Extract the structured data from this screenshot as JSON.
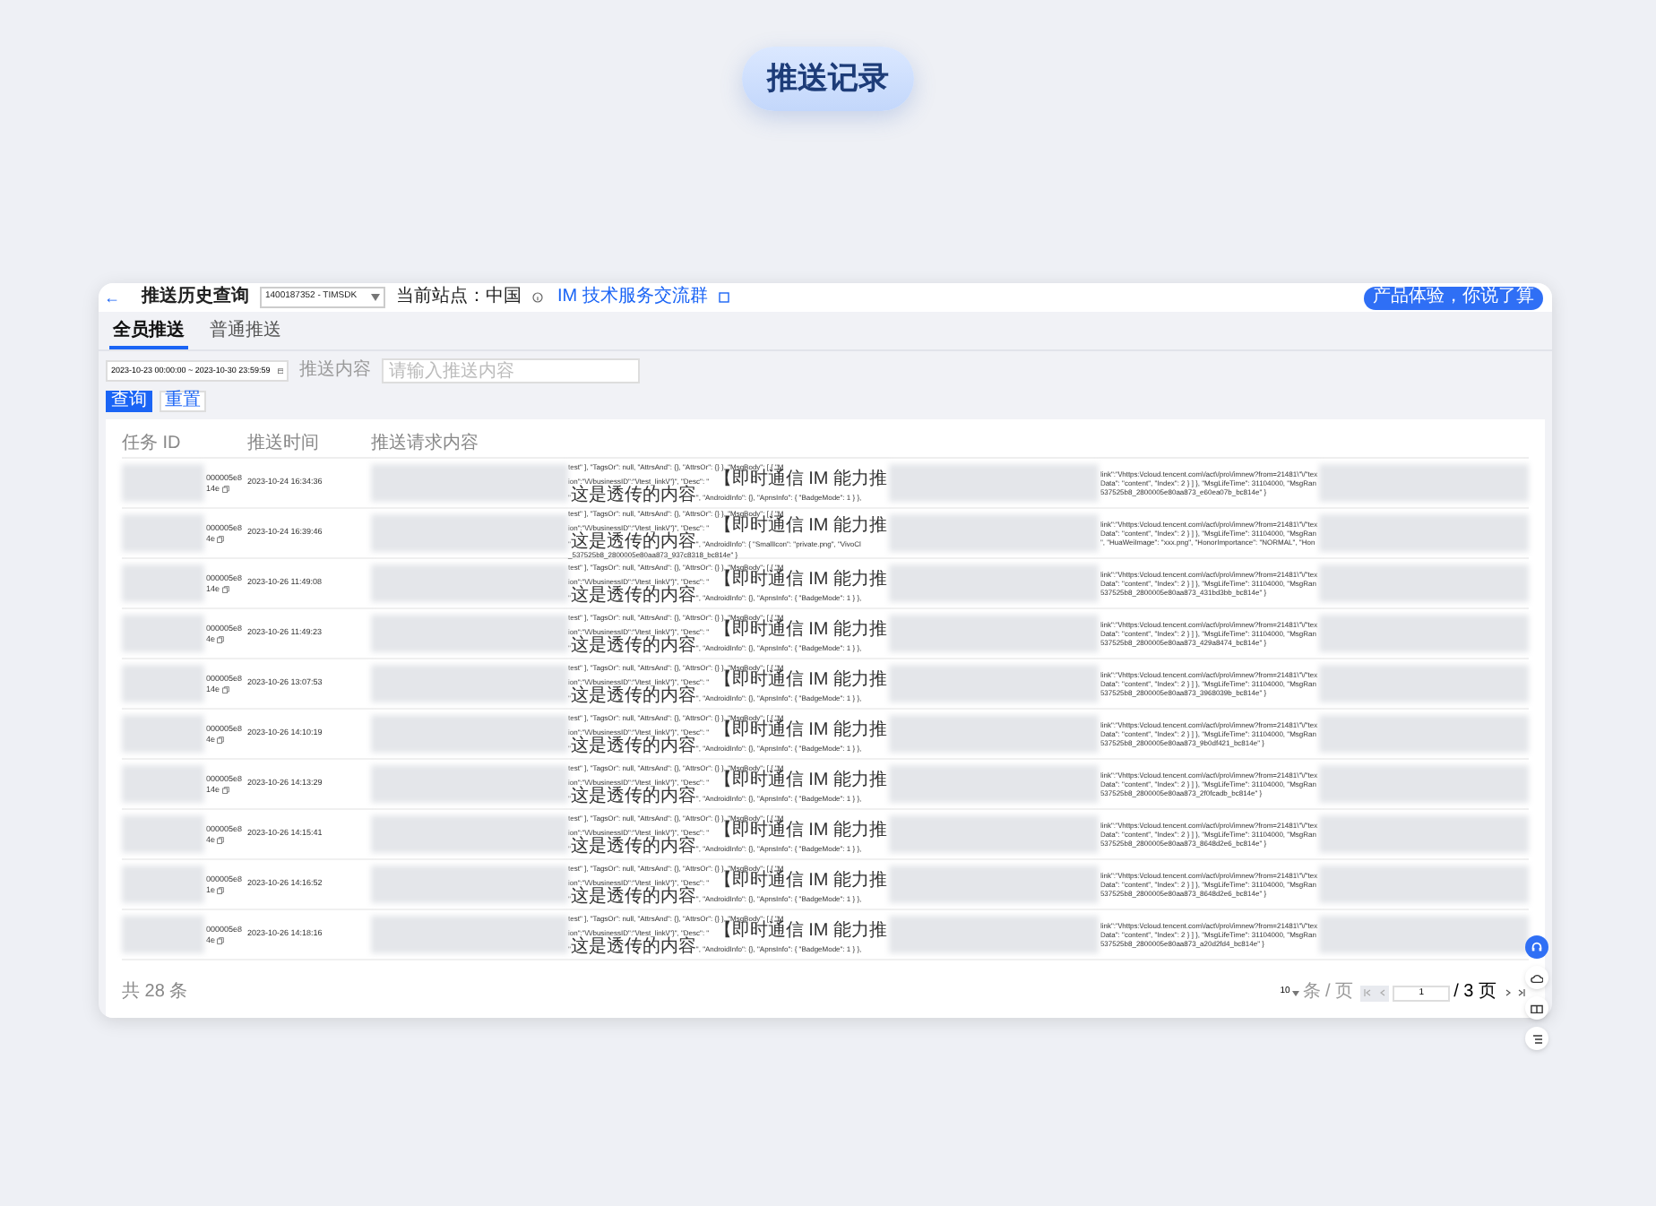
{
  "page_title": "推送记录",
  "window": {
    "back": "←",
    "title": "推送历史查询",
    "app_select": {
      "value": "1400187352 - TIMSDK"
    },
    "site": "当前站点：中国",
    "link": "IM 技术服务交流群",
    "feedback": "产品体验，你说了算"
  },
  "tabs": [
    {
      "label": "全员推送",
      "selected": true
    },
    {
      "label": "普通推送",
      "selected": false
    }
  ],
  "filters": {
    "date_range": "2023-10-23 00:00:00 ~ 2023-10-30 23:59:59",
    "content_label": "推送内容",
    "content_placeholder": "请输入推送内容"
  },
  "buttons": [
    {
      "label": "查询",
      "kind": "primary"
    },
    {
      "label": "重置",
      "kind": "secondary"
    }
  ],
  "table": {
    "columns": [
      "任务 ID",
      "推送时间",
      "推送请求内容"
    ],
    "rows": [
      {
        "id": [
          "000005e8",
          "14e"
        ],
        "time": "2023-10-24 16:34:36",
        "content_a": [
          "test\" ], \"TagsOr\": null, \"AttrsAnd\": {}, \"AttrsOr\": {} }, \"MsgBody\": [ { \"M",
          "ion\":\"\\/\\/businessID\":\"\\/test_link\\/\"}\", \"Desc\": \" 【即时通信 IM 能力推",
          "\"这是透传的内容\", \"AndroidInfo\": {}, \"ApnsInfo\": { \"BadgeMode\": 1 } },"
        ],
        "content_b": [
          "link\":\"\\/https:\\/cloud.tencent.com\\/act\\/pro\\/imnew?from=21481\\\"\\/\"tex",
          "Data\": \"content\", \"Index\": 2 } ] }, \"MsgLifeTime\": 31104000, \"MsgRan",
          "537525b8_2800005e80aa873_e60ea07b_bc814e\" }"
        ]
      },
      {
        "id": [
          "000005e8",
          "4e"
        ],
        "time": "2023-10-24 16:39:46",
        "content_a": [
          "test\" ], \"TagsOr\": null, \"AttrsAnd\": {}, \"AttrsOr\": {} }, \"MsgBody\": [ { \"M",
          "ion\":\"\\/\\/businessID\":\"\\/test_link\\/\"}\", \"Desc\": \" 【即时通信 IM 能力推",
          "\"这是透传的内容\", \"AndroidInfo\": { \"SmallIcon\": \"private.png\", \"VivoCl",
          "_537525b8_2800005e80aa873_937c8318_bc814e\" }"
        ],
        "content_b": [
          "link\":\"\\/https:\\/cloud.tencent.com\\/act\\/pro\\/imnew?from=21481\\\"\\/\"tex",
          "Data\": \"content\", \"Index\": 2 } ] }, \"MsgLifeTime\": 31104000, \"MsgRan",
          "\", \"HuaWeiImage\": \"xxx.png\", \"HonorImportance\": \"NORMAL\", \"Hon"
        ]
      },
      {
        "id": [
          "000005e8",
          "14e"
        ],
        "time": "2023-10-26 11:49:08",
        "content_a": [
          "test\" ], \"TagsOr\": null, \"AttrsAnd\": {}, \"AttrsOr\": {} }, \"MsgBody\": [ { \"M",
          "ion\":\"\\/\\/businessID\":\"\\/test_link\\/\"}\", \"Desc\": \" 【即时通信 IM 能力推",
          "\"这是透传的内容\", \"AndroidInfo\": {}, \"ApnsInfo\": { \"BadgeMode\": 1 } },"
        ],
        "content_b": [
          "link\":\"\\/https:\\/cloud.tencent.com\\/act\\/pro\\/imnew?from=21481\\\"\\/\"tex",
          "Data\": \"content\", \"Index\": 2 } ] }, \"MsgLifeTime\": 31104000, \"MsgRan",
          "537525b8_2800005e80aa873_431bd3bb_bc814e\" }"
        ]
      },
      {
        "id": [
          "000005e8",
          "4e"
        ],
        "time": "2023-10-26 11:49:23",
        "content_a": [
          "test\" ], \"TagsOr\": null, \"AttrsAnd\": {}, \"AttrsOr\": {} }, \"MsgBody\": [ { \"M",
          "ion\":\"\\/\\/businessID\":\"\\/test_link\\/\"}\", \"Desc\": \" 【即时通信 IM 能力推",
          "\"这是透传的内容\", \"AndroidInfo\": {}, \"ApnsInfo\": { \"BadgeMode\": 1 } },"
        ],
        "content_b": [
          "link\":\"\\/https:\\/cloud.tencent.com\\/act\\/pro\\/imnew?from=21481\\\"\\/\"tex",
          "Data\": \"content\", \"Index\": 2 } ] }, \"MsgLifeTime\": 31104000, \"MsgRan",
          "537525b8_2800005e80aa873_429a8474_bc814e\" }"
        ]
      },
      {
        "id": [
          "000005e8",
          "14e"
        ],
        "time": "2023-10-26 13:07:53",
        "content_a": [
          "test\" ], \"TagsOr\": null, \"AttrsAnd\": {}, \"AttrsOr\": {} }, \"MsgBody\": [ { \"M",
          "ion\":\"\\/\\/businessID\":\"\\/test_link\\/\"}\", \"Desc\": \" 【即时通信 IM 能力推",
          "\"这是透传的内容\", \"AndroidInfo\": {}, \"ApnsInfo\": { \"BadgeMode\": 1 } },"
        ],
        "content_b": [
          "link\":\"\\/https:\\/cloud.tencent.com\\/act\\/pro\\/imnew?from=21481\\\"\\/\"tex",
          "Data\": \"content\", \"Index\": 2 } ] }, \"MsgLifeTime\": 31104000, \"MsgRan",
          "537525b8_2800005e80aa873_3968039b_bc814e\" }"
        ]
      },
      {
        "id": [
          "000005e8",
          "4e"
        ],
        "time": "2023-10-26 14:10:19",
        "content_a": [
          "test\" ], \"TagsOr\": null, \"AttrsAnd\": {}, \"AttrsOr\": {} }, \"MsgBody\": [ { \"M",
          "ion\":\"\\/\\/businessID\":\"\\/test_link\\/\"}\", \"Desc\": \" 【即时通信 IM 能力推",
          "\"这是透传的内容\", \"AndroidInfo\": {}, \"ApnsInfo\": { \"BadgeMode\": 1 } },"
        ],
        "content_b": [
          "link\":\"\\/https:\\/cloud.tencent.com\\/act\\/pro\\/imnew?from=21481\\\"\\/\"tex",
          "Data\": \"content\", \"Index\": 2 } ] }, \"MsgLifeTime\": 31104000, \"MsgRan",
          "537525b8_2800005e80aa873_9b0df421_bc814e\" }"
        ]
      },
      {
        "id": [
          "000005e8",
          "14e"
        ],
        "time": "2023-10-26 14:13:29",
        "content_a": [
          "test\" ], \"TagsOr\": null, \"AttrsAnd\": {}, \"AttrsOr\": {} }, \"MsgBody\": [ { \"M",
          "ion\":\"\\/\\/businessID\":\"\\/test_link\\/\"}\", \"Desc\": \" 【即时通信 IM 能力推",
          "\"这是透传的内容\", \"AndroidInfo\": {}, \"ApnsInfo\": { \"BadgeMode\": 1 } },"
        ],
        "content_b": [
          "link\":\"\\/https:\\/cloud.tencent.com\\/act\\/pro\\/imnew?from=21481\\\"\\/\"tex",
          "Data\": \"content\", \"Index\": 2 } ] }, \"MsgLifeTime\": 31104000, \"MsgRan",
          "537525b8_2800005e80aa873_2f0fcadb_bc814e\" }"
        ]
      },
      {
        "id": [
          "000005e8",
          "4e"
        ],
        "time": "2023-10-26 14:15:41",
        "content_a": [
          "test\" ], \"TagsOr\": null, \"AttrsAnd\": {}, \"AttrsOr\": {} }, \"MsgBody\": [ { \"M",
          "ion\":\"\\/\\/businessID\":\"\\/test_link\\/\"}\", \"Desc\": \" 【即时通信 IM 能力推",
          "\"这是透传的内容\", \"AndroidInfo\": {}, \"ApnsInfo\": { \"BadgeMode\": 1 } },"
        ],
        "content_b": [
          "link\":\"\\/https:\\/cloud.tencent.com\\/act\\/pro\\/imnew?from=21481\\\"\\/\"tex",
          "Data\": \"content\", \"Index\": 2 } ] }, \"MsgLifeTime\": 31104000, \"MsgRan",
          "537525b8_2800005e80aa873_8648d2e6_bc814e\" }"
        ]
      },
      {
        "id": [
          "000005e8",
          "1e"
        ],
        "time": "2023-10-26 14:16:52",
        "content_a": [
          "test\" ], \"TagsOr\": null, \"AttrsAnd\": {}, \"AttrsOr\": {} }, \"MsgBody\": [ { \"M",
          "ion\":\"\\/\\/businessID\":\"\\/test_link\\/\"}\", \"Desc\": \" 【即时通信 IM 能力推",
          "\"这是透传的内容\", \"AndroidInfo\": {}, \"ApnsInfo\": { \"BadgeMode\": 1 } },"
        ],
        "content_b": [
          "link\":\"\\/https:\\/cloud.tencent.com\\/act\\/pro\\/imnew?from=21481\\\"\\/\"tex",
          "Data\": \"content\", \"Index\": 2 } ] }, \"MsgLifeTime\": 31104000, \"MsgRan",
          "537525b8_2800005e80aa873_8648d2e6_bc814e\" }"
        ]
      },
      {
        "id": [
          "000005e8",
          "4e"
        ],
        "time": "2023-10-26 14:18:16",
        "content_a": [
          "test\" ], \"TagsOr\": null, \"AttrsAnd\": {}, \"AttrsOr\": {} }, \"MsgBody\": [ { \"M",
          "ion\":\"\\/\\/businessID\":\"\\/test_link\\/\"}\", \"Desc\": \" 【即时通信 IM 能力推",
          "\"这是透传的内容\", \"AndroidInfo\": {}, \"ApnsInfo\": { \"BadgeMode\": 1 } },"
        ],
        "content_b": [
          "link\":\"\\/https:\\/cloud.tencent.com\\/act\\/pro\\/imnew?from=21481\\\"\\/\"tex",
          "Data\": \"content\", \"Index\": 2 } ] }, \"MsgLifeTime\": 31104000, \"MsgRan",
          "537525b8_2800005e80aa873_a20d2fd4_bc814e\" }"
        ]
      }
    ]
  },
  "pagination": {
    "total": "共 28 条",
    "page_size": "10",
    "page_size_unit": "条 / 页",
    "page": "1",
    "page_count": "/ 3 页"
  }
}
